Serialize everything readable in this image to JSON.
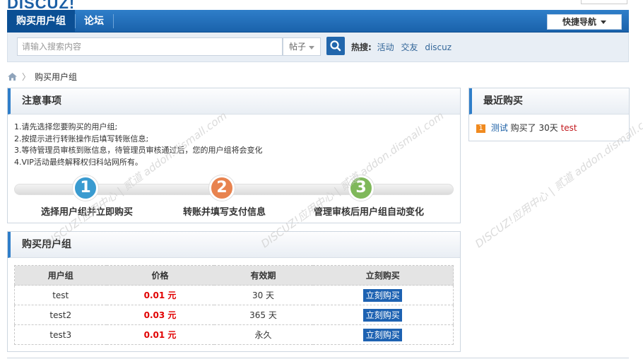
{
  "logo_text": "DISCUZ!",
  "nav": {
    "items": [
      {
        "label": "购买用户组",
        "active": true
      },
      {
        "label": "论坛",
        "active": false
      }
    ],
    "quick_nav": "快捷导航"
  },
  "search": {
    "placeholder": "请输入搜索内容",
    "type": "帖子",
    "hot_label": "热搜:",
    "hot_links": [
      "活动",
      "交友",
      "discuz"
    ]
  },
  "breadcrumb": {
    "current": "购买用户组"
  },
  "notice": {
    "title": "注意事项",
    "lines": [
      "1.请先选择您要购买的用户组;",
      "2.按提示进行转账操作后填写转账信息;",
      "3.等待管理员审核到账信息，待管理员审核通过后，您的用户组将会变化",
      "4.VIP活动最终解释权归科站网所有。"
    ],
    "steps": [
      {
        "number": "1",
        "label": "选择用户组并立即购买",
        "color": "#3a9bd0"
      },
      {
        "number": "2",
        "label": "转账并填写支付信息",
        "color": "#e8834f"
      },
      {
        "number": "3",
        "label": "管理审核后用户组自动变化",
        "color": "#7fb85a"
      }
    ]
  },
  "groups": {
    "title": "购买用户组",
    "headers": [
      "用户组",
      "价格",
      "有效期",
      "立刻购买"
    ],
    "rows": [
      {
        "name": "test",
        "price": "0.01 元",
        "period": "30 天",
        "action": "立刻购买"
      },
      {
        "name": "test2",
        "price": "0.03 元",
        "period": "365 天",
        "action": "立刻购买"
      },
      {
        "name": "test3",
        "price": "0.01 元",
        "period": "永久",
        "action": "立刻购买"
      }
    ]
  },
  "recent": {
    "title": "最近购买",
    "items": [
      {
        "index": "1",
        "user": "测试",
        "text": "购买了 30天",
        "group": "test"
      }
    ]
  },
  "watermark": "DISCUZ!应用中心 | 贰道 addon.dismall.com"
}
